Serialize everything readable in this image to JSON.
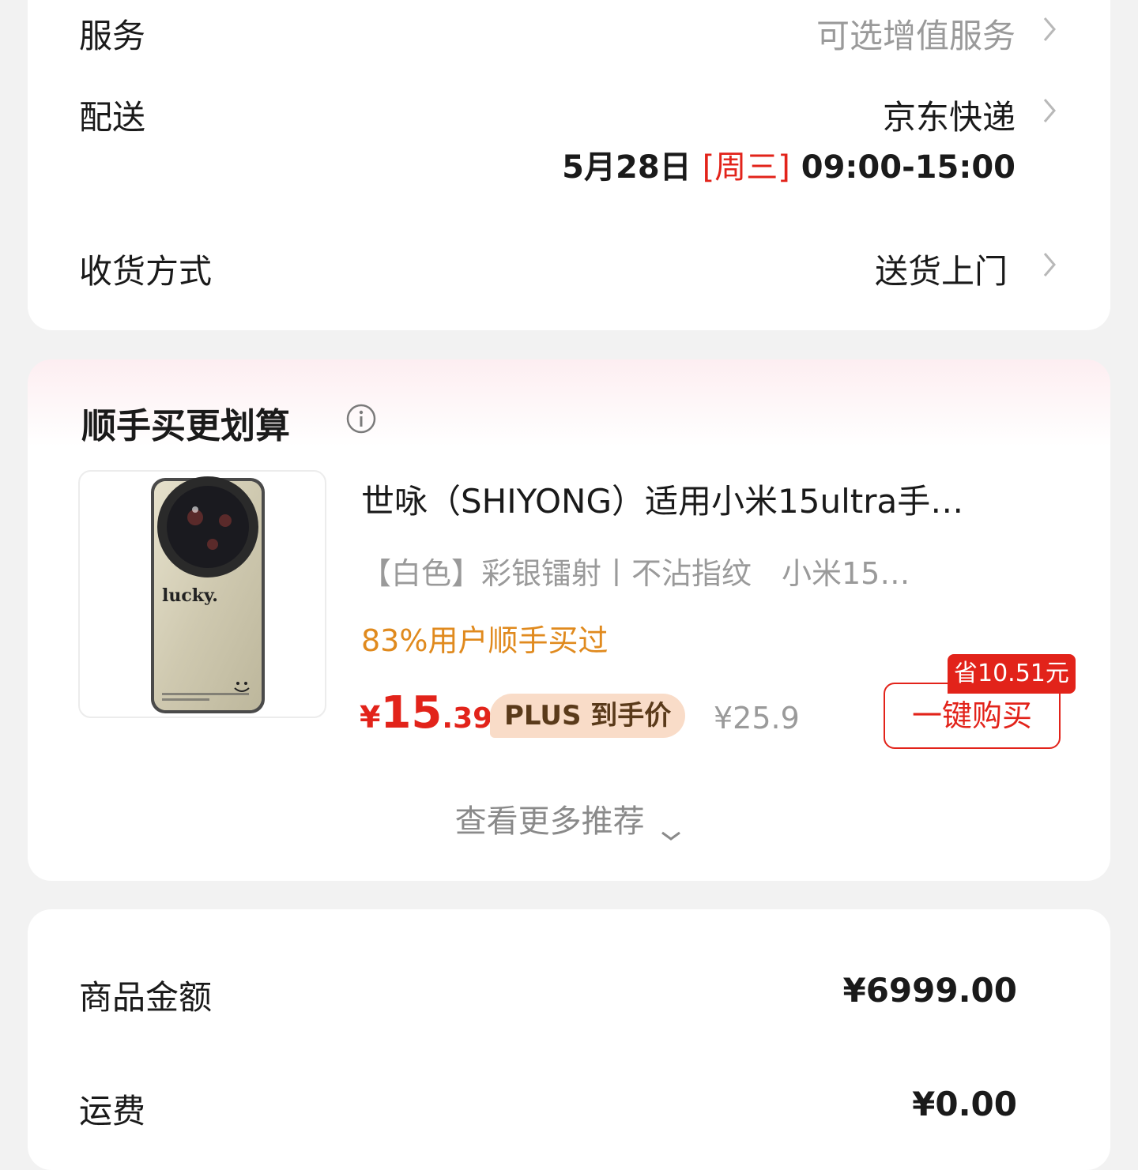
{
  "services_card": {
    "service": {
      "label": "服务",
      "value": "可选增值服务"
    },
    "delivery": {
      "label": "配送",
      "carrier": "京东快递",
      "date": "5月28日",
      "weekday": "[周三]",
      "time_range": "09:00-15:00"
    },
    "receive_method": {
      "label": "收货方式",
      "value": "送货上门"
    }
  },
  "recommend_card": {
    "title": "顺手买更划算",
    "product": {
      "title": "世咏（SHIYONG）适用小米15ultra手…",
      "spec": "【白色】彩银镭射丨不沾指纹　小米15…",
      "social_proof": "83%用户顺手买过",
      "price_currency": "¥",
      "price_integer": "15",
      "price_decimal": ".39",
      "price_tag": "PLUS 到手价",
      "original_price": "¥25.9",
      "save_badge": "省10.51元",
      "buy_button": "一键购买",
      "image_text": "lucky."
    },
    "more_link": "查看更多推荐"
  },
  "summary_card": {
    "goods_amount": {
      "label": "商品金额",
      "value": "¥6999.00"
    },
    "shipping": {
      "label": "运费",
      "value": "¥0.00"
    }
  },
  "colors": {
    "accent_red": "#e2231a",
    "social_orange": "#e08a1e",
    "plus_tag_bg": "#f9dcc8",
    "muted_text": "#9a9a9a"
  }
}
